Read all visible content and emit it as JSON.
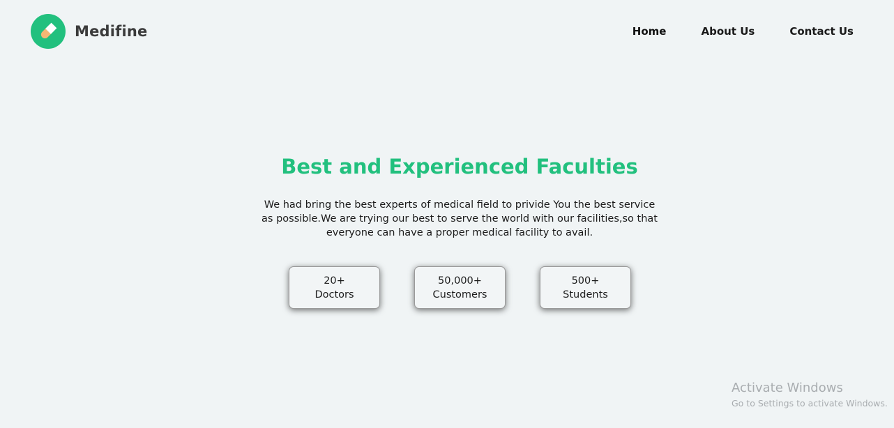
{
  "brand": {
    "name": "Medifine",
    "icon": "pill-icon",
    "color": "#22c07e"
  },
  "nav": {
    "home": "Home",
    "about": "About Us",
    "contact": "Contact Us"
  },
  "hero": {
    "title": "Best and Experienced Faculties",
    "description": "We had bring the best experts of medical field to privide You the best service as possible.We are trying our best to serve the world with our facilities,so that everyone can have a proper medical facility to avail."
  },
  "stats": [
    {
      "value": "20+",
      "label": "Doctors"
    },
    {
      "value": "50,000+",
      "label": "Customers"
    },
    {
      "value": "500+",
      "label": "Students"
    }
  ],
  "watermark": {
    "title": "Activate Windows",
    "subtitle": "Go to Settings to activate Windows."
  }
}
